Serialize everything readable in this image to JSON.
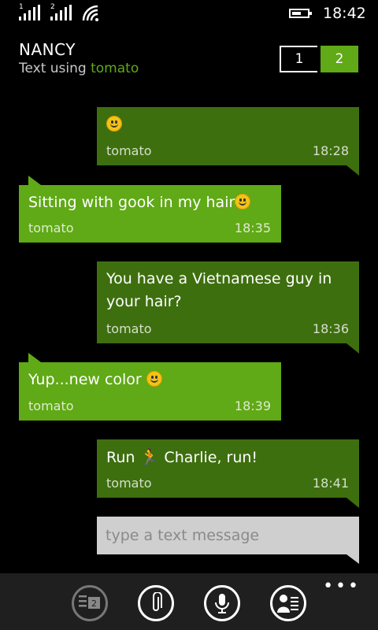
{
  "status": {
    "sim1_label": "1",
    "sim2_label": "2",
    "time": "18:42"
  },
  "header": {
    "contact_name": "NANCY",
    "sub_prefix": "Text using ",
    "sub_app": "tomato",
    "sim_switch": [
      "1",
      "2"
    ],
    "active_sim": "2"
  },
  "messages": [
    {
      "direction": "out",
      "text": "",
      "emoji": "smile-emoji",
      "app": "tomato",
      "time": "18:28"
    },
    {
      "direction": "in",
      "text": "Sitting with gook in my hair",
      "emoji": "smile-emoji",
      "app": "tomato",
      "time": "18:35"
    },
    {
      "direction": "out",
      "text": "You have a Vietnamese guy in your hair?",
      "emoji": "",
      "app": "tomato",
      "time": "18:36"
    },
    {
      "direction": "in",
      "text": "Yup...new color ",
      "emoji": "smile-emoji",
      "app": "tomato",
      "time": "18:39"
    },
    {
      "direction": "out",
      "text_before": "Run ",
      "emoji": "runner-emoji",
      "text_after": " Charlie, run!",
      "app": "tomato",
      "time": "18:41"
    }
  ],
  "compose": {
    "placeholder": "type a text message"
  },
  "appbar": {
    "more": "•••",
    "switch_sim_badge": "2",
    "buttons": [
      "switch-sim-icon",
      "attach-icon",
      "microphone-icon",
      "contact-card-icon"
    ]
  },
  "colors": {
    "accent": "#60a917",
    "outgoing_bubble": "#3e6f0f",
    "compose_bg": "#cfcfcf",
    "appbar_bg": "#1f1f1f"
  }
}
